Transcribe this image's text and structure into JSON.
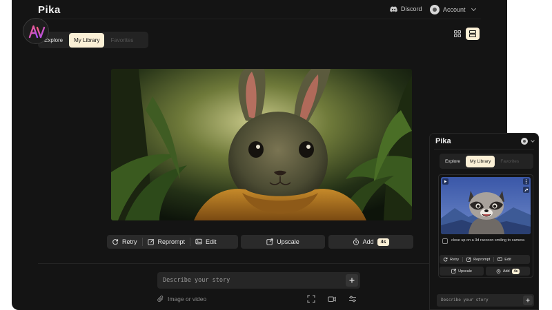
{
  "app": {
    "logo": "Pika"
  },
  "header": {
    "discord_label": "Discord",
    "account_label": "Account"
  },
  "tabs": [
    {
      "label": "Explore",
      "active": false
    },
    {
      "label": "My Library",
      "active": true
    },
    {
      "label": "Favorites",
      "active": false
    }
  ],
  "view_toggle": {
    "grid_icon": "grid-icon",
    "list_icon": "list-icon",
    "selected": "list"
  },
  "actions": {
    "retry": "Retry",
    "reprompt": "Reprompt",
    "edit": "Edit",
    "upscale": "Upscale",
    "add": "Add",
    "duration": "4s"
  },
  "prompt": {
    "placeholder": "Describe your story"
  },
  "attach": {
    "label": "Image or video"
  },
  "side_panel": {
    "logo": "Pika",
    "tabs": [
      {
        "label": "Explore",
        "active": false
      },
      {
        "label": "My Library",
        "active": true
      },
      {
        "label": "Favorites",
        "active": false
      }
    ],
    "card_caption": "close up on a 3d raccoon smiling to camera",
    "actions": {
      "retry": "Retry",
      "reprompt": "Reprompt",
      "edit": "Edit",
      "upscale": "Upscale",
      "add": "Add",
      "duration": "4s"
    },
    "prompt_placeholder": "Describe your story"
  },
  "colors": {
    "background": "#141414",
    "accent": "#fbf0d6",
    "panel": "#262626"
  }
}
